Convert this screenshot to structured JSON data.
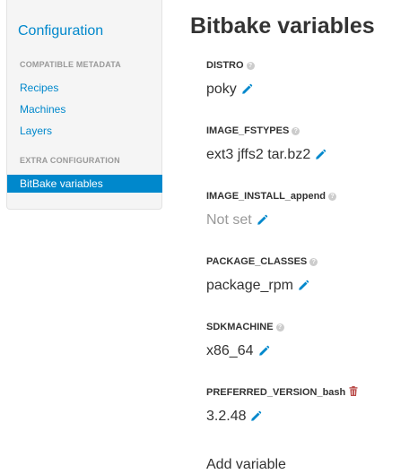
{
  "sidebar": {
    "title": "Configuration",
    "sections": {
      "compatible_metadata": "COMPATIBLE METADATA",
      "extra_configuration": "EXTRA CONFIGURATION"
    },
    "links": {
      "recipes": "Recipes",
      "machines": "Machines",
      "layers": "Layers",
      "bitbake_variables": "BitBake variables"
    },
    "active_item": "bitbake_variables"
  },
  "main": {
    "title": "Bitbake variables",
    "variables": [
      {
        "name": "DISTRO",
        "value": "poky",
        "is_set": true,
        "icon": "help-icon"
      },
      {
        "name": "IMAGE_FSTYPES",
        "value": "ext3 jffs2 tar.bz2",
        "is_set": true,
        "icon": "help-icon"
      },
      {
        "name": "IMAGE_INSTALL_append",
        "value": "Not set",
        "is_set": false,
        "icon": "help-icon"
      },
      {
        "name": "PACKAGE_CLASSES",
        "value": "package_rpm",
        "is_set": true,
        "icon": "help-icon"
      },
      {
        "name": "SDKMACHINE",
        "value": "x86_64",
        "is_set": true,
        "icon": "help-icon"
      },
      {
        "name": "PREFERRED_VERSION_bash",
        "value": "3.2.48",
        "is_set": true,
        "icon": "trash-icon"
      }
    ],
    "add_variable_label": "Add variable"
  },
  "colors": {
    "link": "#0088cc",
    "active_bg": "#0088cc",
    "muted_text": "#999999",
    "help_icon": "#cccccc",
    "delete_icon": "#b94a48",
    "text": "#333333"
  }
}
